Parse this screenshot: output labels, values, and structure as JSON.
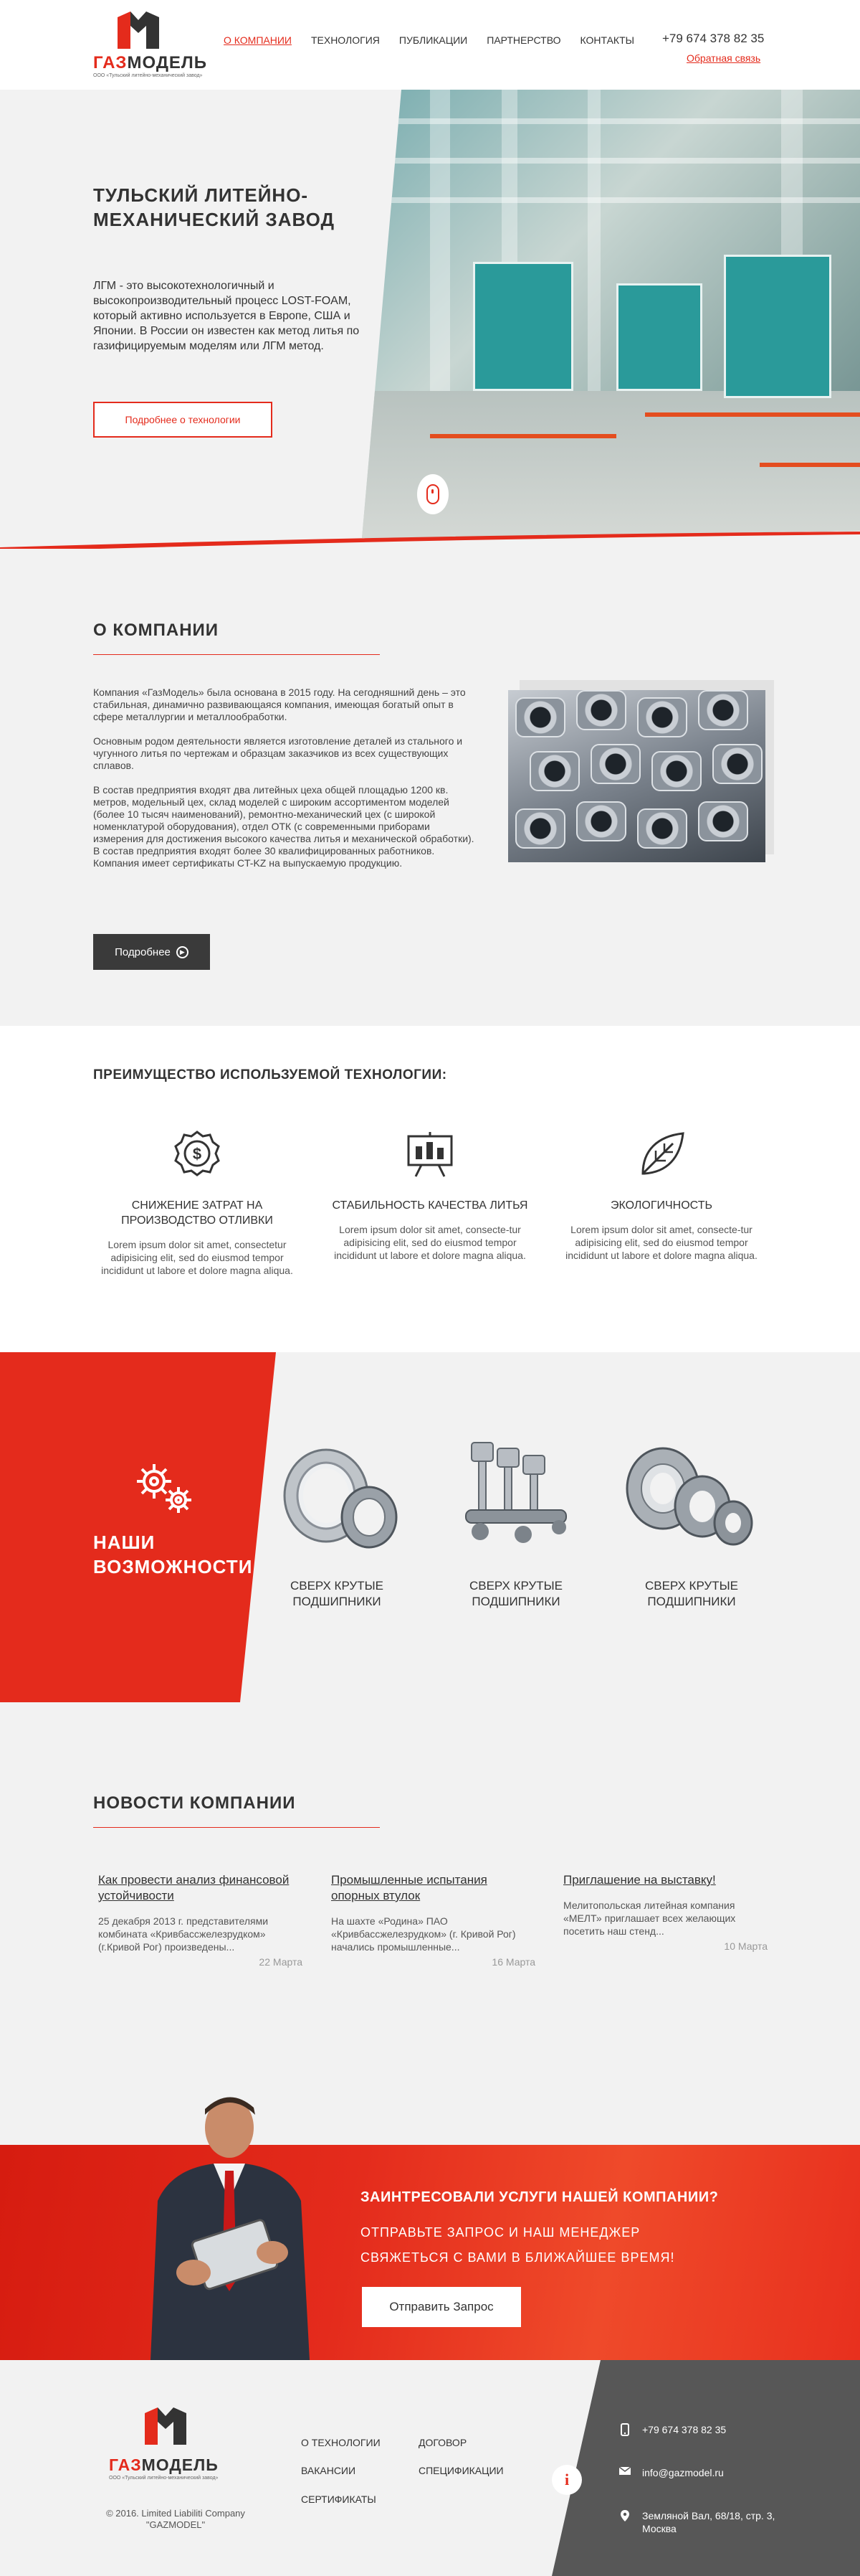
{
  "header": {
    "logo_main_red": "ГАЗ",
    "logo_main_dark": "МОДЕЛЬ",
    "logo_sub": "ООО «Тульский литейно-механический завод»",
    "nav": [
      "О КОМПАНИИ",
      "ТЕХНОЛОГИЯ",
      "ПУБЛИКАЦИИ",
      "ПАРТНЕРСТВО",
      "КОНТАКТЫ"
    ],
    "phone": "+79 674 378 82 35",
    "feedback": "Обратная связь"
  },
  "hero": {
    "title": "ТУЛЬСКИЙ ЛИТЕЙНО-МЕХАНИЧЕСКИЙ ЗАВОД",
    "text": "ЛГМ - это высокотехнологичный и высокопроизводительный процесс LOST-FOAM, который активно используется в Европе, США и Японии. В России он известен как метод литья по газифицируемым моделям или ЛГМ метод.",
    "button": "Подробнее о технологии"
  },
  "about": {
    "title": "О КОМПАНИИ",
    "paragraphs": [
      "Компания «ГазМодель» была основана в 2015 году. На сегодняшний день – это стабильная, динамично развивающаяся компания, имеющая богатый опыт в сфере металлургии и металлообработки.",
      "Основным родом деятельности является изготовление деталей из стального и чугунного литья по чертежам и образцам заказчиков из всех существующих сплавов.",
      "В состав предприятия входят два литейных цеха общей площадью 1200 кв. метров, модельный цех, склад моделей с широким ассортиментом моделей (более 10 тысяч наименований), ремонтно-механический цех (с широкой номенклатурой оборудования), отдел ОТК (с современными приборами измерения для достижения высокого качества литья и механической обработки). В состав предприятия входят более 30 квалифицированных работников. Компания имеет сертификаты CT-KZ на выпускаемую продукцию."
    ],
    "button": "Подробнее"
  },
  "advantages": {
    "title": "ПРЕИМУЩЕСТВО ИСПОЛЬЗУЕМОЙ ТЕХНОЛОГИИ:",
    "items": [
      {
        "name": "СНИЖЕНИЕ ЗАТРАТ НА ПРОИЗВОДСТВО ОТЛИВКИ",
        "desc": "Lorem ipsum dolor sit amet, consectetur adipisicing elit, sed do eiusmod tempor incididunt ut labore et dolore magna aliqua.",
        "icon": "dollar-gear-icon"
      },
      {
        "name": "СТАБИЛЬНОСТЬ КАЧЕСТВА ЛИТЬЯ",
        "desc": "Lorem ipsum dolor sit amet, consecte-tur adipisicing elit, sed do eiusmod tempor incididunt ut labore et dolore magna aliqua.",
        "icon": "chart-board-icon"
      },
      {
        "name": "ЭКОЛОГИЧНОСТЬ",
        "desc": "Lorem ipsum dolor sit amet, consecte-tur adipisicing elit, sed do eiusmod tempor incididunt ut labore et dolore magna aliqua.",
        "icon": "leaf-icon"
      }
    ]
  },
  "capabilities": {
    "title": "НАШИ ВОЗМОЖНОСТИ",
    "items": [
      {
        "label": "СВЕРХ КРУТЫЕ ПОДШИПНИКИ"
      },
      {
        "label": "СВЕРХ КРУТЫЕ ПОДШИПНИКИ"
      },
      {
        "label": "СВЕРХ КРУТЫЕ ПОДШИПНИКИ"
      }
    ]
  },
  "news": {
    "title": "НОВОСТИ КОМПАНИИ",
    "items": [
      {
        "head": "Как провести анализ финансовой устойчивости",
        "text": "25 декабря 2013 г. представителями комбината «Кривбассжелезрудком» (г.Кривой Рог) произведены...",
        "date": "22 Марта"
      },
      {
        "head": "Промышленные испытания опорных втулок",
        "text": "На шахте «Родина» ПАО «Кривбассжелезрудком» (г. Кривой Рог) начались промышленные...",
        "date": "16 Марта"
      },
      {
        "head": "Приглашение на выставку!",
        "text": "Мелитопольская литейная компания «МЕЛТ» приглашает всех желающих посетить наш стенд...",
        "date": "10 Марта"
      }
    ]
  },
  "cta": {
    "title": "ЗАИНТРЕСОВАЛИ УСЛУГИ НАШЕЙ КОМПАНИИ?",
    "line1": "ОТПРАВЬТЕ ЗАПРОС И НАШ МЕНЕДЖЕР",
    "line2": "СВЯЖЕТЬСЯ С ВАМИ В БЛИЖАЙШЕЕ ВРЕМЯ!",
    "button": "Отправить Запрос"
  },
  "footer": {
    "logo_red": "ГАЗ",
    "logo_dark": "МОДЕЛЬ",
    "logo_sub": "ООО «Тульский литейно-механический завод»",
    "copyright": "© 2016. Limited Liabiliti Company \"GAZMODEL\"",
    "links": [
      "О ТЕХНОЛОГИИ",
      "ДОГОВОР",
      "ВАКАНСИИ",
      "СПЕЦИФИКАЦИИ",
      "СЕРТИФИКАТЫ"
    ],
    "phone": "+79 674 378 82 35",
    "email": "info@gazmodel.ru",
    "address": "Земляной Вал, 68/18, стр. 3, Москва"
  }
}
